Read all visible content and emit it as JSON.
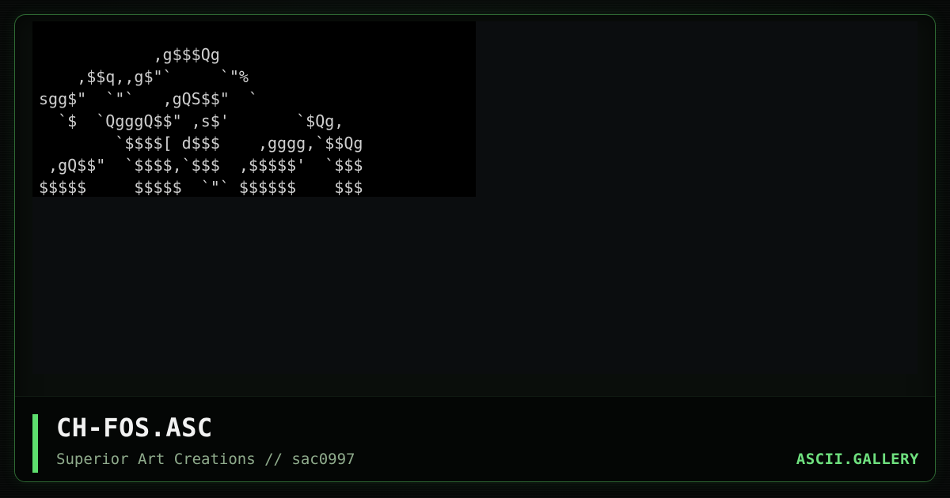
{
  "artwork": {
    "lines": [
      "            ,g$$$Qg",
      "    ,$$q,,g$\"`     `\"%",
      "sgg$\"  `\"`   ,gQS$$\"  `",
      "  `$  `QgggQ$$\" ,s$'       `$Qg,",
      "        `$$$$[ d$$$    ,gggg,`$$Qg",
      " ,gQ$$\"  `$$$$,`$$$  ,$$$$$'  `$$$",
      "$$$$$     $$$$$  `\"` $$$$$$    $$$"
    ]
  },
  "footer": {
    "title": "CH-FOS.ASC",
    "subtitle": "Superior Art Creations // sac0997",
    "brand": "ASCII.GALLERY"
  },
  "colors": {
    "accent": "#5dde6e",
    "brand": "#6fe07f",
    "frame_border": "#2f6b34",
    "art_text": "#cfcfcf"
  }
}
